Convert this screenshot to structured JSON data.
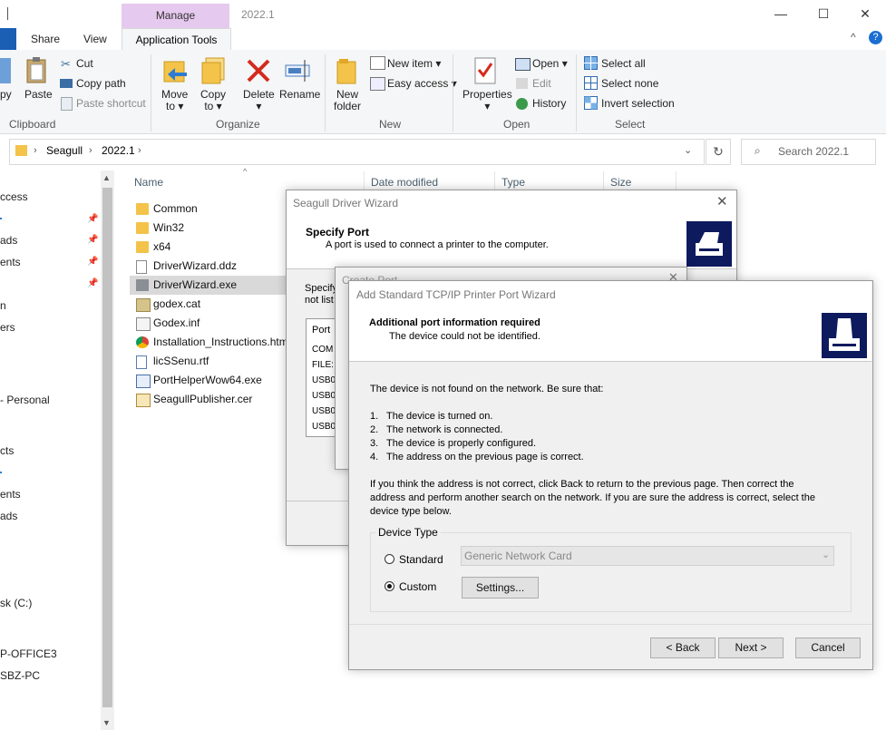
{
  "window": {
    "title": "2022.1",
    "manage_tab": "Manage",
    "minimize": "—",
    "maximize": "☐",
    "close": "✕"
  },
  "ribbon_tabs": {
    "share": "Share",
    "view": "View",
    "app_tools": "Application Tools",
    "collapse": "^",
    "help": "?"
  },
  "ribbon": {
    "clipboard": {
      "copy": "py",
      "paste": "Paste",
      "cut": "Cut",
      "copy_path": "Copy path",
      "paste_shortcut": "Paste shortcut",
      "label": "Clipboard"
    },
    "organize": {
      "move_to": "Move",
      "move_to2": "to",
      "copy_to": "Copy",
      "copy_to2": "to",
      "delete": "Delete",
      "rename": "Rename",
      "label": "Organize"
    },
    "new": {
      "new_folder": "New",
      "new_folder2": "folder",
      "new_item": "New item",
      "easy_access": "Easy access",
      "label": "New"
    },
    "open": {
      "properties": "Properties",
      "open": "Open",
      "edit": "Edit",
      "history": "History",
      "label": "Open"
    },
    "select": {
      "select_all": "Select all",
      "select_none": "Select none",
      "invert": "Invert selection",
      "label": "Select"
    }
  },
  "address": {
    "crumbs": [
      "Seagull",
      "2022.1"
    ],
    "search_placeholder": "Search 2022.1"
  },
  "nav": [
    "ccess",
    "ads",
    "ents",
    "n",
    "ers",
    "- Personal",
    "cts",
    "ents",
    "ads",
    "sk (C:)",
    "P-OFFICE3",
    "SBZ-PC"
  ],
  "columns": {
    "name": "Name",
    "date": "Date modified",
    "type": "Type",
    "size": "Size"
  },
  "files": [
    "Common",
    "Win32",
    "x64",
    "DriverWizard.ddz",
    "DriverWizard.exe",
    "godex.cat",
    "Godex.inf",
    "Installation_Instructions.htm",
    "licSSenu.rtf",
    "PortHelperWow64.exe",
    "SeagullPublisher.cer"
  ],
  "driver_wizard": {
    "title": "Seagull Driver Wizard",
    "heading": "Specify Port",
    "sub": "A port is used to connect a printer to the computer.",
    "body1": "Specify",
    "body2": "not list",
    "port_header": "Port",
    "ports": [
      "COM",
      "FILE:",
      "USB0",
      "USB0",
      "USB0",
      "USB0"
    ]
  },
  "create_port": {
    "title": "Create Port"
  },
  "tcpip": {
    "title": "Add Standard TCP/IP Printer Port Wizard",
    "heading": "Additional port information required",
    "sub": "The device could not be identified.",
    "intro": "The device is not found on the network.  Be sure that:",
    "items": [
      {
        "num": "1.",
        "text": "The device is turned on."
      },
      {
        "num": "2.",
        "text": "The network is connected."
      },
      {
        "num": "3.",
        "text": "The device is properly configured."
      },
      {
        "num": "4.",
        "text": "The address on the previous page is correct."
      }
    ],
    "para1": "If you think the address is not correct, click Back to return to the previous page.  Then correct the",
    "para2": "address and perform another search on the network.  If you are sure the address is correct, select the",
    "para3": "device type below.",
    "device_type": "Device Type",
    "standard": "Standard",
    "standard_value": "Generic Network Card",
    "custom": "Custom",
    "settings": "Settings...",
    "back": "< Back",
    "next": "Next >",
    "cancel": "Cancel"
  }
}
